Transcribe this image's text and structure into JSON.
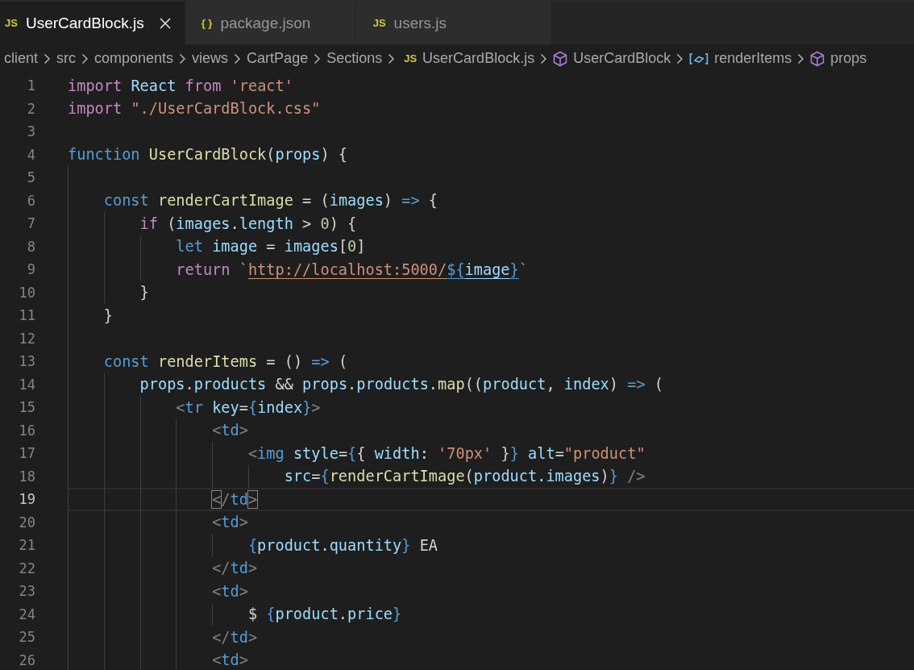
{
  "tabs": [
    {
      "label": "UserCardBlock.js",
      "badge": "JS",
      "selected": true
    },
    {
      "label": "package.json",
      "badge": "{ }",
      "selected": false
    },
    {
      "label": "users.js",
      "badge": "JS",
      "selected": false
    }
  ],
  "breadcrumbs": [
    {
      "label": "client",
      "kind": "folder"
    },
    {
      "label": "src",
      "kind": "folder"
    },
    {
      "label": "components",
      "kind": "folder"
    },
    {
      "label": "views",
      "kind": "folder"
    },
    {
      "label": "CartPage",
      "kind": "folder"
    },
    {
      "label": "Sections",
      "kind": "folder"
    },
    {
      "label": "UserCardBlock.js",
      "kind": "file",
      "badge": "JS"
    },
    {
      "label": "UserCardBlock",
      "kind": "class"
    },
    {
      "label": "renderItems",
      "kind": "variable"
    },
    {
      "label": "props",
      "kind": "class"
    }
  ],
  "lines": [
    {
      "number": "1",
      "current": false,
      "tokens": [
        {
          "text": "import",
          "kind": "control"
        },
        {
          "text": " React",
          "kind": "variable"
        },
        {
          "text": " from",
          "kind": "control"
        },
        {
          "text": " 'react'",
          "kind": "string"
        }
      ]
    },
    {
      "number": "2",
      "current": false,
      "tokens": [
        {
          "text": "import",
          "kind": "control"
        },
        {
          "text": " \"./UserCardBlock.css\"",
          "kind": "string"
        }
      ]
    },
    {
      "number": "3",
      "current": false
    },
    {
      "number": "4",
      "current": false,
      "tokens": [
        {
          "text": "function",
          "kind": "keyword"
        },
        {
          "text": " UserCardBlock",
          "kind": "function"
        },
        {
          "text": "(",
          "kind": "plain"
        },
        {
          "text": "props",
          "kind": "variable"
        },
        {
          "text": ") {",
          "kind": "plain"
        }
      ]
    },
    {
      "number": "5",
      "current": false
    },
    {
      "number": "6",
      "current": false,
      "tokens": [
        {
          "text": "    const",
          "kind": "keyword"
        },
        {
          "text": " renderCartImage",
          "kind": "function"
        },
        {
          "text": " = (",
          "kind": "plain"
        },
        {
          "text": "images",
          "kind": "variable"
        },
        {
          "text": ") ",
          "kind": "plain"
        },
        {
          "text": "=>",
          "kind": "keyword"
        },
        {
          "text": " {",
          "kind": "plain"
        }
      ]
    },
    {
      "number": "7",
      "current": false,
      "tokens": [
        {
          "text": "        if",
          "kind": "control"
        },
        {
          "text": " (",
          "kind": "plain"
        },
        {
          "text": "images",
          "kind": "variable"
        },
        {
          "text": ".",
          "kind": "plain"
        },
        {
          "text": "length",
          "kind": "variable"
        },
        {
          "text": " > ",
          "kind": "plain"
        },
        {
          "text": "0",
          "kind": "number"
        },
        {
          "text": ") {",
          "kind": "plain"
        }
      ]
    },
    {
      "number": "8",
      "current": false,
      "tokens": [
        {
          "text": "            let",
          "kind": "keyword"
        },
        {
          "text": " image",
          "kind": "variable"
        },
        {
          "text": " = ",
          "kind": "plain"
        },
        {
          "text": "images",
          "kind": "variable"
        },
        {
          "text": "[",
          "kind": "plain"
        },
        {
          "text": "0",
          "kind": "number"
        },
        {
          "text": "]",
          "kind": "plain"
        }
      ]
    },
    {
      "number": "9",
      "current": false,
      "tokens": [
        {
          "text": "            return",
          "kind": "control"
        },
        {
          "text": " `",
          "kind": "string"
        },
        {
          "text": "http://localhost:5000/",
          "kind": "string",
          "link": true
        },
        {
          "text": "${",
          "kind": "keyword",
          "link": true
        },
        {
          "text": "image",
          "kind": "variable",
          "link": true
        },
        {
          "text": "}",
          "kind": "keyword",
          "link": true
        },
        {
          "text": "`",
          "kind": "string"
        }
      ]
    },
    {
      "number": "10",
      "current": false,
      "tokens": [
        {
          "text": "        }",
          "kind": "plain"
        }
      ]
    },
    {
      "number": "11",
      "current": false,
      "tokens": [
        {
          "text": "    }",
          "kind": "plain"
        }
      ]
    },
    {
      "number": "12",
      "current": false
    },
    {
      "number": "13",
      "current": false,
      "tokens": [
        {
          "text": "    const",
          "kind": "keyword"
        },
        {
          "text": " renderItems",
          "kind": "function"
        },
        {
          "text": " = () ",
          "kind": "plain"
        },
        {
          "text": "=>",
          "kind": "keyword"
        },
        {
          "text": " (",
          "kind": "plain"
        }
      ]
    },
    {
      "number": "14",
      "current": false,
      "tokens": [
        {
          "text": "        props",
          "kind": "variable"
        },
        {
          "text": ".",
          "kind": "plain"
        },
        {
          "text": "products",
          "kind": "variable"
        },
        {
          "text": " && ",
          "kind": "plain"
        },
        {
          "text": "props",
          "kind": "variable"
        },
        {
          "text": ".",
          "kind": "plain"
        },
        {
          "text": "products",
          "kind": "variable"
        },
        {
          "text": ".",
          "kind": "plain"
        },
        {
          "text": "map",
          "kind": "function"
        },
        {
          "text": "((",
          "kind": "plain"
        },
        {
          "text": "product",
          "kind": "variable"
        },
        {
          "text": ", ",
          "kind": "plain"
        },
        {
          "text": "index",
          "kind": "variable"
        },
        {
          "text": ") ",
          "kind": "plain"
        },
        {
          "text": "=>",
          "kind": "keyword"
        },
        {
          "text": " (",
          "kind": "plain"
        }
      ]
    },
    {
      "number": "15",
      "current": false,
      "tokens": [
        {
          "text": "            <",
          "kind": "tag"
        },
        {
          "text": "tr",
          "kind": "keyword"
        },
        {
          "text": " key",
          "kind": "variable"
        },
        {
          "text": "=",
          "kind": "plain"
        },
        {
          "text": "{",
          "kind": "keyword"
        },
        {
          "text": "index",
          "kind": "variable"
        },
        {
          "text": "}",
          "kind": "keyword"
        },
        {
          "text": ">",
          "kind": "tag"
        }
      ]
    },
    {
      "number": "16",
      "current": false,
      "tokens": [
        {
          "text": "                <",
          "kind": "tag"
        },
        {
          "text": "td",
          "kind": "keyword"
        },
        {
          "text": ">",
          "kind": "tag"
        }
      ]
    },
    {
      "number": "17",
      "current": false,
      "tokens": [
        {
          "text": "                    <",
          "kind": "tag"
        },
        {
          "text": "img",
          "kind": "keyword"
        },
        {
          "text": " style",
          "kind": "variable"
        },
        {
          "text": "=",
          "kind": "plain"
        },
        {
          "text": "{",
          "kind": "keyword"
        },
        {
          "text": "{ ",
          "kind": "plain"
        },
        {
          "text": "width",
          "kind": "variable"
        },
        {
          "text": ": ",
          "kind": "plain"
        },
        {
          "text": "'70px'",
          "kind": "string"
        },
        {
          "text": " }",
          "kind": "plain"
        },
        {
          "text": "}",
          "kind": "keyword"
        },
        {
          "text": " alt",
          "kind": "variable"
        },
        {
          "text": "=",
          "kind": "plain"
        },
        {
          "text": "\"product\"",
          "kind": "string"
        }
      ]
    },
    {
      "number": "18",
      "current": false,
      "tokens": [
        {
          "text": "                        src",
          "kind": "variable"
        },
        {
          "text": "=",
          "kind": "plain"
        },
        {
          "text": "{",
          "kind": "keyword"
        },
        {
          "text": "renderCartImage",
          "kind": "function"
        },
        {
          "text": "(",
          "kind": "plain"
        },
        {
          "text": "product",
          "kind": "variable"
        },
        {
          "text": ".",
          "kind": "plain"
        },
        {
          "text": "images",
          "kind": "variable"
        },
        {
          "text": ")",
          "kind": "plain"
        },
        {
          "text": "}",
          "kind": "keyword"
        },
        {
          "text": " />",
          "kind": "tag"
        }
      ]
    },
    {
      "number": "19",
      "current": true,
      "tokens": [
        {
          "text": "                <",
          "kind": "tag",
          "matched": true
        },
        {
          "text": "/",
          "kind": "tag"
        },
        {
          "text": "td",
          "kind": "keyword"
        },
        {
          "text": ">",
          "kind": "tag",
          "matched": true
        }
      ]
    },
    {
      "number": "20",
      "current": false,
      "tokens": [
        {
          "text": "                <",
          "kind": "tag"
        },
        {
          "text": "td",
          "kind": "keyword"
        },
        {
          "text": ">",
          "kind": "tag"
        }
      ]
    },
    {
      "number": "21",
      "current": false,
      "tokens": [
        {
          "text": "                    {",
          "kind": "keyword"
        },
        {
          "text": "product",
          "kind": "variable"
        },
        {
          "text": ".",
          "kind": "plain"
        },
        {
          "text": "quantity",
          "kind": "variable"
        },
        {
          "text": "}",
          "kind": "keyword"
        },
        {
          "text": " EA",
          "kind": "plain"
        }
      ]
    },
    {
      "number": "22",
      "current": false,
      "tokens": [
        {
          "text": "                </",
          "kind": "tag"
        },
        {
          "text": "td",
          "kind": "keyword"
        },
        {
          "text": ">",
          "kind": "tag"
        }
      ]
    },
    {
      "number": "23",
      "current": false,
      "tokens": [
        {
          "text": "                <",
          "kind": "tag"
        },
        {
          "text": "td",
          "kind": "keyword"
        },
        {
          "text": ">",
          "kind": "tag"
        }
      ]
    },
    {
      "number": "24",
      "current": false,
      "tokens": [
        {
          "text": "                    $ ",
          "kind": "plain"
        },
        {
          "text": "{",
          "kind": "keyword"
        },
        {
          "text": "product",
          "kind": "variable"
        },
        {
          "text": ".",
          "kind": "plain"
        },
        {
          "text": "price",
          "kind": "variable"
        },
        {
          "text": "}",
          "kind": "keyword"
        }
      ]
    },
    {
      "number": "25",
      "current": false,
      "tokens": [
        {
          "text": "                </",
          "kind": "tag"
        },
        {
          "text": "td",
          "kind": "keyword"
        },
        {
          "text": ">",
          "kind": "tag"
        }
      ]
    },
    {
      "number": "26",
      "current": false,
      "tokens": [
        {
          "text": "                <",
          "kind": "tag"
        },
        {
          "text": "td",
          "kind": "keyword"
        },
        {
          "text": ">",
          "kind": "tag"
        }
      ]
    }
  ]
}
